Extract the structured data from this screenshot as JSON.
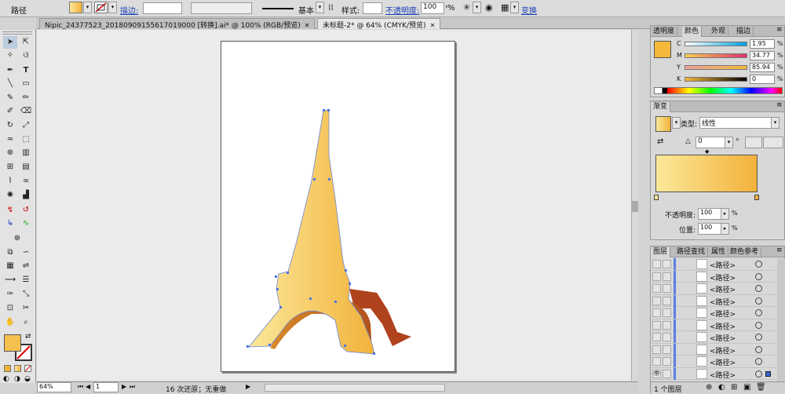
{
  "control_bar": {
    "object_type": "路径",
    "stroke_label": "描边:",
    "stroke_style_label": "基本",
    "style_label": "样式:",
    "opacity_label": "不透明度:",
    "opacity_value": "100",
    "opacity_unit": "%",
    "transform_label": "变换"
  },
  "tabs": [
    {
      "label": "Nipic_24377523_20180909155617019000 [转换].ai* @ 100% (RGB/预览)",
      "close": "✕",
      "active": false
    },
    {
      "label": "未标题-2* @ 64% (CMYK/预览)",
      "close": "✕",
      "active": true
    }
  ],
  "status": {
    "zoom": "64%",
    "page": "1",
    "undo_text": "16 次还原；无重做"
  },
  "color_panel": {
    "tabs": [
      "透明度",
      "颜色",
      "外观",
      "描边"
    ],
    "active_tab": "颜色",
    "swatch": "#f5b83a",
    "channels": [
      {
        "key": "C",
        "value": "1.95",
        "unit": "%"
      },
      {
        "key": "M",
        "value": "34.77",
        "unit": "%"
      },
      {
        "key": "Y",
        "value": "85.94",
        "unit": "%"
      },
      {
        "key": "K",
        "value": "0",
        "unit": "%"
      }
    ]
  },
  "gradient_panel": {
    "title": "渐变",
    "type_label": "类型:",
    "type_value": "线性",
    "angle_value": "0",
    "opacity_label": "不透明度:",
    "opacity_value": "100",
    "opacity_unit": "%",
    "position_label": "位置:",
    "position_value": "100",
    "position_unit": "%",
    "start_color": "#fbe89a",
    "end_color": "#f2b23a"
  },
  "layers_panel": {
    "tabs": [
      "图层",
      "路径查找",
      "属性",
      "颜色参考"
    ],
    "rows": [
      "<路径>",
      "<路径>",
      "<路径>",
      "<路径>",
      "<路径>",
      "<路径>",
      "<路径>",
      "<路径>",
      "<路径>",
      "<路径>"
    ],
    "footer": "1 个图层"
  },
  "tools": {
    "fill_color": "#f5c050",
    "stroke_color": "#ffffff"
  }
}
